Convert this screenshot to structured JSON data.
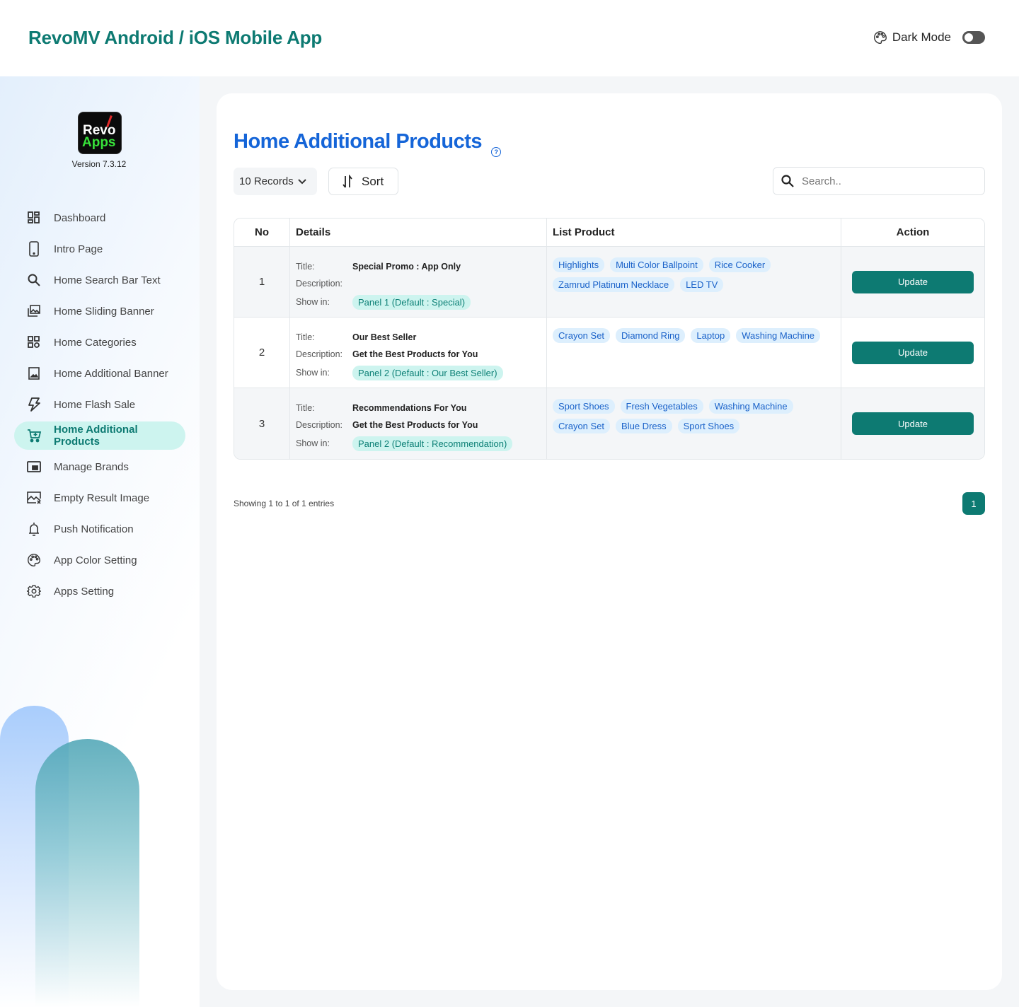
{
  "header": {
    "app_title": "RevoMV Android / iOS Mobile App",
    "dark_mode_label": "Dark Mode",
    "dark_mode_on": false
  },
  "sidebar": {
    "logo_line1": "Revo",
    "logo_line2": "Apps",
    "version": "Version 7.3.12",
    "items": [
      {
        "label": "Dashboard",
        "icon": "dashboard-icon"
      },
      {
        "label": "Intro Page",
        "icon": "phone-icon"
      },
      {
        "label": "Home Search Bar Text",
        "icon": "search-icon"
      },
      {
        "label": "Home Sliding Banner",
        "icon": "images-icon"
      },
      {
        "label": "Home Categories",
        "icon": "categories-icon"
      },
      {
        "label": "Home Additional Banner",
        "icon": "image-icon"
      },
      {
        "label": "Home Flash Sale",
        "icon": "flash-icon"
      },
      {
        "label": "Home Additional Products",
        "icon": "cart-plus-icon",
        "active": true
      },
      {
        "label": "Manage Brands",
        "icon": "brand-icon"
      },
      {
        "label": "Empty Result Image",
        "icon": "image-x-icon"
      },
      {
        "label": "Push Notification",
        "icon": "bell-icon"
      },
      {
        "label": "App Color Setting",
        "icon": "palette-icon"
      },
      {
        "label": "Apps Setting",
        "icon": "gear-icon"
      }
    ]
  },
  "main": {
    "title": "Home Additional Products",
    "help_glyph": "?",
    "records_label": "10 Records",
    "sort_label": "Sort",
    "search_placeholder": "Search..",
    "table": {
      "headers": [
        "No",
        "Details",
        "List Product",
        "Action"
      ],
      "detail_labels": {
        "title": "Title:",
        "description": "Description:",
        "show_in": "Show in:"
      },
      "rows": [
        {
          "no": "1",
          "title": "Special Promo : App Only",
          "description": "",
          "show_in": "Panel 1 (Default : Special)",
          "products": [
            "Highlights",
            "Multi Color Ballpoint",
            "Rice Cooker",
            "Zamrud Platinum Necklace",
            "LED TV"
          ],
          "action": "Update"
        },
        {
          "no": "2",
          "title": "Our Best Seller",
          "description": "Get the Best Products for You",
          "show_in": "Panel 2 (Default : Our Best Seller)",
          "products": [
            "Crayon Set",
            "Diamond Ring",
            "Laptop",
            "Washing Machine"
          ],
          "action": "Update"
        },
        {
          "no": "3",
          "title": "Recommendations For You",
          "description": "Get the Best Products for You",
          "show_in": "Panel 2 (Default : Recommendation)",
          "products": [
            "Sport Shoes",
            "Fresh Vegetables",
            "Washing Machine",
            "Crayon Set",
            "Blue Dress",
            "Sport Shoes"
          ],
          "action": "Update"
        }
      ]
    },
    "showing_text": "Showing 1 to 1 of 1 entries",
    "current_page": "1"
  },
  "colors": {
    "brand_teal": "#0d7a72",
    "title_blue": "#1565d8",
    "active_bg": "#cdf4ef",
    "tag_bg": "#ddeffd",
    "tag_text": "#1a62c9"
  }
}
